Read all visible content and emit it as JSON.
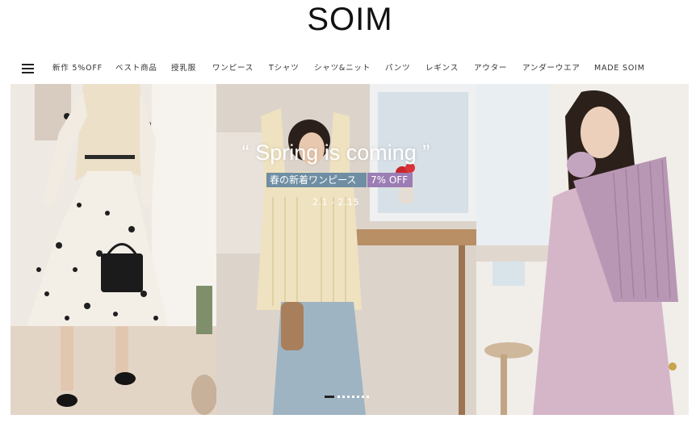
{
  "brand": {
    "logo": "SOIM"
  },
  "nav": {
    "menu_icon": "hamburger-menu-icon",
    "items": [
      "新作 5%OFF",
      "ベスト商品",
      "授乳服",
      "ワンピース",
      "Tシャツ",
      "シャツ&ニット",
      "パンツ",
      "レギンス",
      "アウター",
      "アンダーウエア",
      "MADE SOIM"
    ]
  },
  "banner": {
    "headline": "“ Spring is coming ”",
    "subtitle": "春の新着ワンピース",
    "discount": "7% OFF",
    "date_range": "2.1 - 2.15",
    "slides_total": 8,
    "active_slide": 1
  },
  "colors": {
    "subtitle_bg": "#6f8ea3",
    "discount_bg": "#9b7db3",
    "text": "#222222"
  }
}
